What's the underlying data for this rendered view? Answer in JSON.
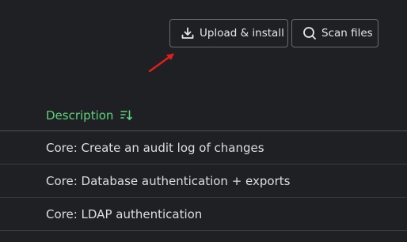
{
  "toolbar": {
    "upload_label": "Upload & install",
    "scan_label": "Scan files",
    "upload_icon": "download-icon",
    "scan_icon": "search-icon"
  },
  "table": {
    "columns": [
      {
        "label": "Description",
        "sort_icon": "sort-icon"
      }
    ],
    "rows": [
      {
        "description": "Core: Create an audit log of changes"
      },
      {
        "description": "Core: Database authentication + exports"
      },
      {
        "description": "Core: LDAP authentication"
      }
    ]
  },
  "colors": {
    "background": "#1f2023",
    "accent": "#5fd17c",
    "annotation_arrow": "#e0201e"
  }
}
